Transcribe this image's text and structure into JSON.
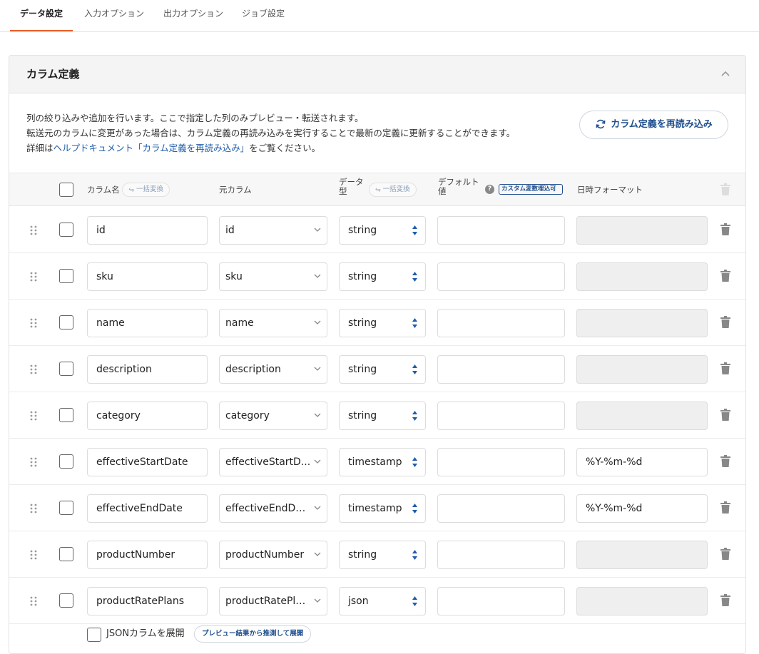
{
  "tabs": [
    {
      "label": "データ設定",
      "active": true
    },
    {
      "label": "入力オプション",
      "active": false
    },
    {
      "label": "出力オプション",
      "active": false
    },
    {
      "label": "ジョブ設定",
      "active": false
    }
  ],
  "card": {
    "title": "カラム定義",
    "desc_line1": "列の絞り込みや追加を行います。ここで指定した列のみプレビュー・転送されます。",
    "desc_line2": "転送元のカラムに変更があった場合は、カラム定義の再読み込みを実行することで最新の定義に更新することができます。",
    "desc_line3_prefix": "詳細は",
    "desc_link": "ヘルプドキュメント「カラム定義を再読み込み」",
    "desc_line3_suffix": "をご覧ください。",
    "reload_label": "カラム定義を再読み込み"
  },
  "table": {
    "headers": {
      "column_name": "カラム名",
      "bulk_convert": "一括変換",
      "source_column": "元カラム",
      "data_type_1": "データ",
      "data_type_2": "型",
      "default_1": "デフォルト",
      "default_2": "値",
      "help": "?",
      "custom_badge": "カスタム変数埋込可",
      "datetime_format": "日時フォーマット"
    },
    "rows": [
      {
        "name": "id",
        "source": "id",
        "type": "string",
        "default": "",
        "format": ""
      },
      {
        "name": "sku",
        "source": "sku",
        "type": "string",
        "default": "",
        "format": ""
      },
      {
        "name": "name",
        "source": "name",
        "type": "string",
        "default": "",
        "format": ""
      },
      {
        "name": "description",
        "source": "description",
        "type": "string",
        "default": "",
        "format": ""
      },
      {
        "name": "category",
        "source": "category",
        "type": "string",
        "default": "",
        "format": ""
      },
      {
        "name": "effectiveStartDate",
        "source": "effectiveStartD...",
        "type": "timestamp",
        "default": "",
        "format": "%Y-%m-%d"
      },
      {
        "name": "effectiveEndDate",
        "source": "effectiveEndDate",
        "type": "timestamp",
        "default": "",
        "format": "%Y-%m-%d"
      },
      {
        "name": "productNumber",
        "source": "productNumber",
        "type": "string",
        "default": "",
        "format": ""
      },
      {
        "name": "productRatePlans",
        "source": "productRatePla...",
        "type": "json",
        "default": "",
        "format": ""
      }
    ]
  },
  "json_option": {
    "label": "JSONカラムを展開",
    "button": "プレビュー結果から推測して展開"
  },
  "colors": {
    "accent": "#e8612c",
    "link": "#1f5da8",
    "primary": "#1f4f8f"
  }
}
